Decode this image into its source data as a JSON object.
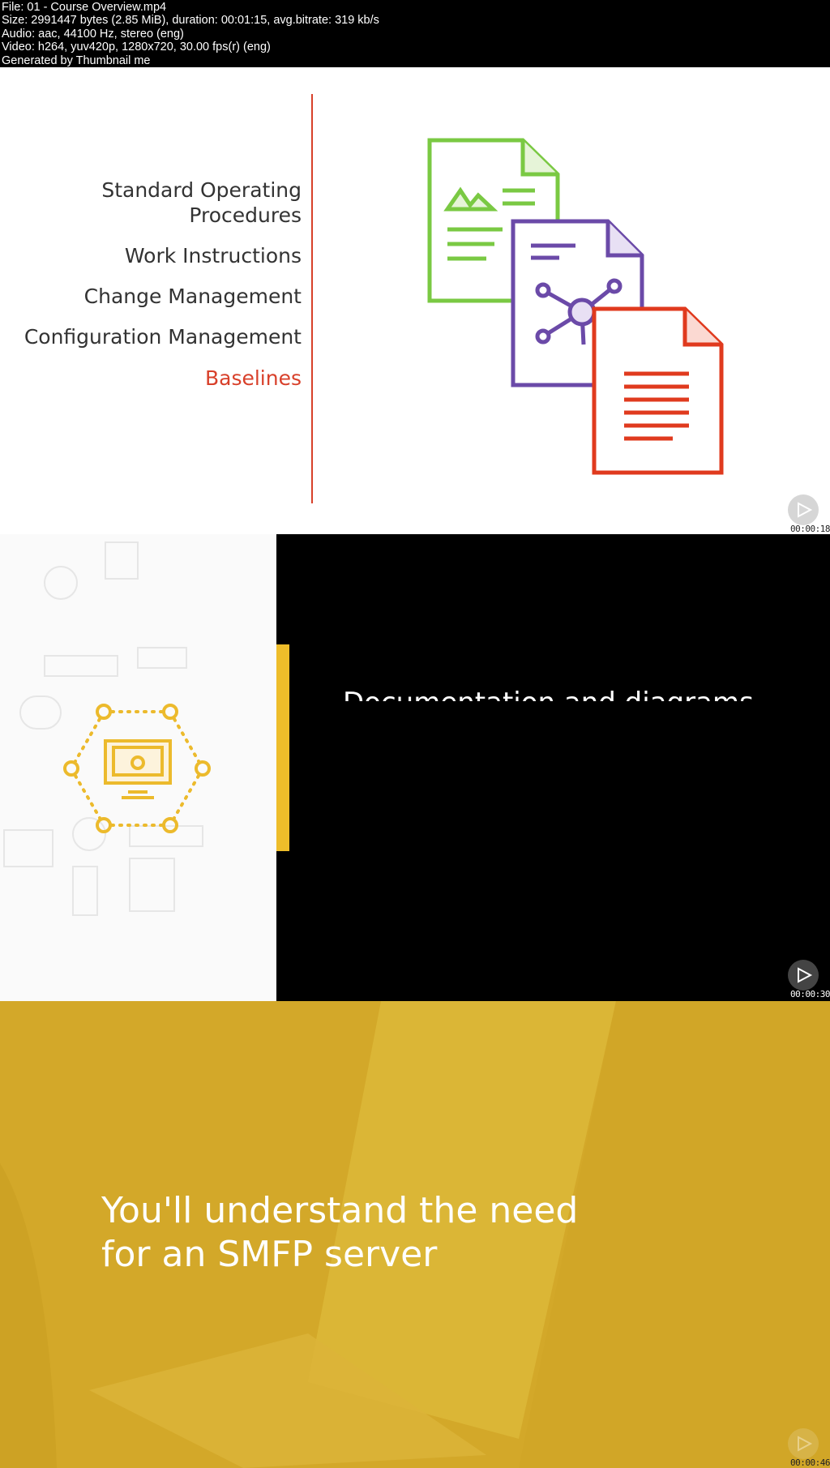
{
  "header": {
    "lines": [
      "File: 01 - Course Overview.mp4",
      "Size: 2991447 bytes (2.85 MiB), duration: 00:01:15, avg.bitrate: 319 kb/s",
      "Audio: aac, 44100 Hz, stereo (eng)",
      "Video: h264, yuv420p, 1280x720, 30.00 fps(r) (eng)",
      "Generated by Thumbnail me"
    ]
  },
  "frame1": {
    "items": [
      "Standard Operating",
      "Procedures",
      "Work Instructions",
      "Change Management",
      "Configuration Management",
      "Baselines"
    ],
    "highlight_color": "#d8402a",
    "icons": [
      "image-document-icon",
      "diagram-document-icon",
      "text-document-icon"
    ],
    "colors": {
      "green": "#7ac943",
      "purple": "#6b4aa8",
      "red": "#e03a1e"
    },
    "timestamp": "00:00:18"
  },
  "frame2": {
    "title": "Documentation and diagrams",
    "accent": "#eebd2a",
    "icon": "network-monitor-gear-icon",
    "timestamp": "00:00:30"
  },
  "frame3": {
    "line1": "You'll understand the need",
    "line2": "for an SMFP server",
    "background": "#d3a829",
    "timestamp": "00:00:46"
  }
}
